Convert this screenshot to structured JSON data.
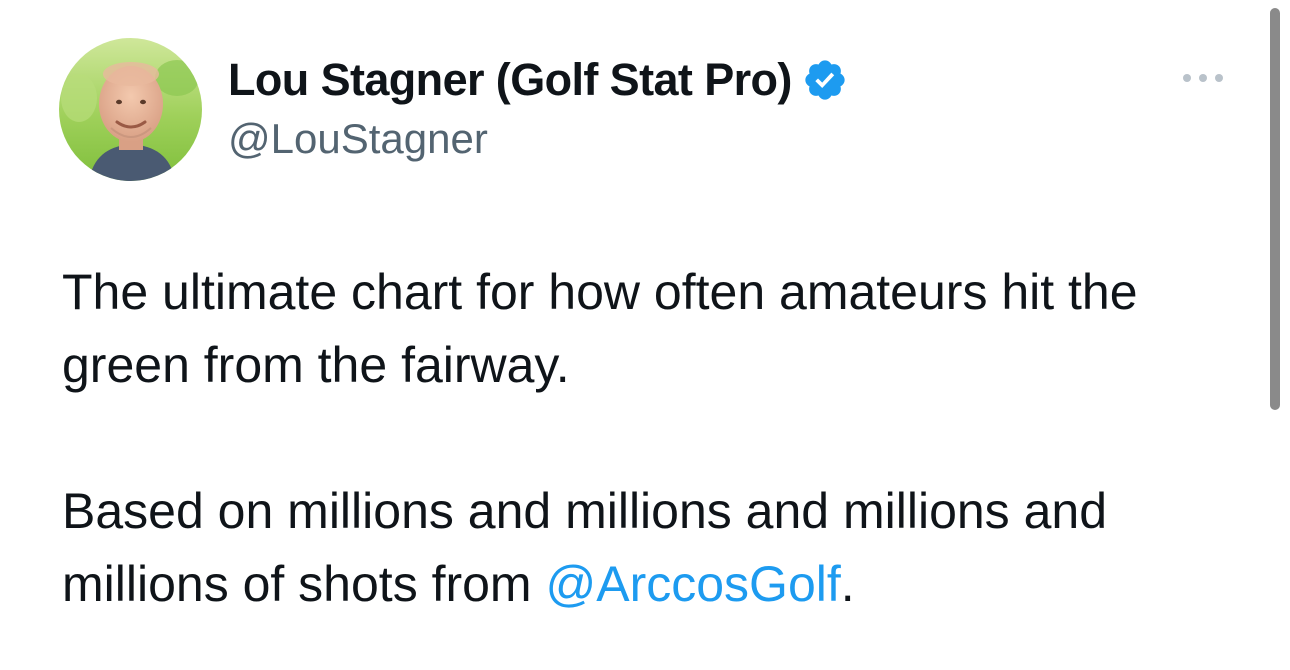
{
  "tweet": {
    "author": {
      "display_name": "Lou Stagner (Golf Stat Pro)",
      "handle": "@LouStagner",
      "verified": true,
      "avatar_icon": "profile-photo"
    },
    "more_icon": "more-options-icon",
    "text": {
      "line1": "The ultimate chart for how often amateurs hit the green from the fairway.",
      "line2_prefix": "Based on millions and millions and millions and millions of shots from ",
      "mention": "@ArccosGolf",
      "line2_suffix": "."
    }
  },
  "colors": {
    "text": "#0f1419",
    "secondary": "#536471",
    "link": "#1d9bf0",
    "verified_badge": "#1d9bf0"
  }
}
